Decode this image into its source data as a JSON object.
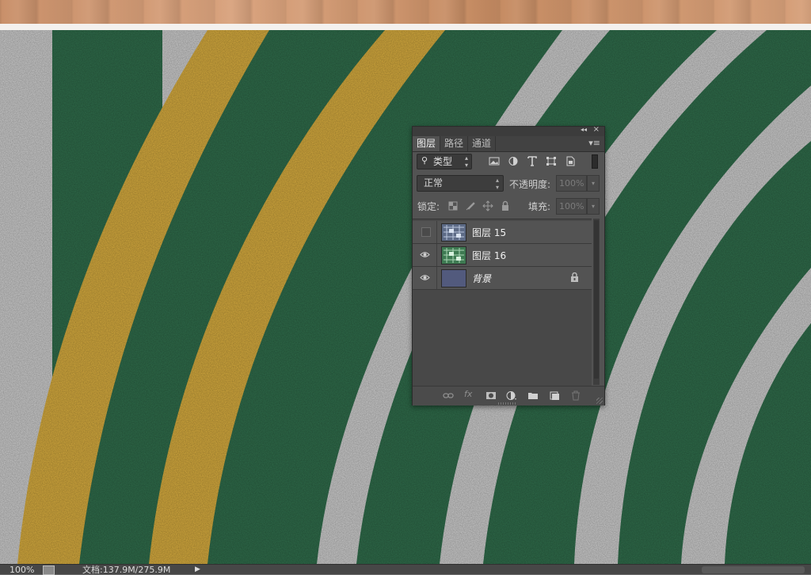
{
  "panel": {
    "tabs": [
      {
        "label": "图层",
        "active": true
      },
      {
        "label": "路径",
        "active": false
      },
      {
        "label": "通道",
        "active": false
      }
    ],
    "collapse_glyph": "◂◂",
    "close_glyph": "×",
    "menu_glyph": "▾≡",
    "filter": {
      "kind_value": "类型",
      "search_icon": "magnifier-icon",
      "icons": [
        "image-filter-icon",
        "adjustment-filter-icon",
        "type-filter-icon",
        "shape-filter-icon",
        "smart-object-filter-icon"
      ]
    },
    "blend_mode": "正常",
    "opacity_label": "不透明度:",
    "opacity_value": "100%",
    "lock_label": "锁定:",
    "fill_label": "填充:",
    "fill_value": "100%",
    "layers": [
      {
        "name": "图层 15",
        "visible": false,
        "thumb": "circuit-thumbnail",
        "locked": false,
        "italic": false
      },
      {
        "name": "图层 16",
        "visible": true,
        "thumb": "green-circuit-thumbnail",
        "locked": false,
        "italic": false
      },
      {
        "name": "背景",
        "visible": true,
        "thumb": "navy-fill-thumbnail",
        "locked": true,
        "italic": true
      }
    ],
    "footer_icons": [
      "link-icon",
      "fx-icon",
      "mask-icon",
      "adjustment-icon",
      "folder-icon",
      "new-layer-icon",
      "trash-icon"
    ],
    "footer_fx": "fx"
  },
  "status": {
    "zoom": "100%",
    "doc_info": "文档:137.9M/275.9M",
    "arrow": "▶"
  },
  "colors": {
    "court_green": "#2f6b4a",
    "line_white": "#c9c9c9",
    "line_gold": "#d3a93e",
    "wood": "#d09a74",
    "panel_bg": "#535353"
  }
}
